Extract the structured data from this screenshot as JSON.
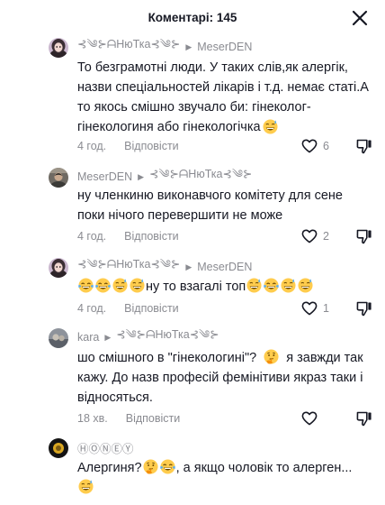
{
  "header": {
    "title": "Коментарі: 145"
  },
  "comments": [
    {
      "author": "⊰༄⊱ᗩНюТка⊰༄⊱",
      "reply_to": "MeserDEN",
      "text": "То безграмотні люди. У таких слів,як алергік, назви спеціальностей лікарів і т.д. немає статі.А то якось смішно звучало би: гінеколог-гінекологиня або гінекологічка",
      "time": "4 год.",
      "reply_label": "Відповісти",
      "likes": "6"
    },
    {
      "author": "MeserDEN",
      "reply_to": "⊰༄⊱ᗩНюТка⊰༄⊱",
      "text": "ну членкиню виконавчого комітету для сене поки нічого перевершити не може",
      "time": "4 год.",
      "reply_label": "Відповісти",
      "likes": "2"
    },
    {
      "author": "⊰༄⊱ᗩНюТка⊰༄⊱",
      "reply_to": "MeserDEN",
      "text": "ну то взагалі топ",
      "time": "4 год.",
      "reply_label": "Відповісти",
      "likes": "1"
    },
    {
      "author": "kara",
      "reply_to": "⊰༄⊱ᗩНюТка⊰༄⊱",
      "text_a": "шо смішного в \"гінекологині\"?",
      "text_b": "я завжди так кажу. До назв професій фемінітиви якраз таки і відносяться.",
      "time": "18 хв.",
      "reply_label": "Відповісти",
      "likes": ""
    },
    {
      "author": "ⒽⓄⓃⒺⓎ",
      "text_a": "Алергиня?",
      "text_b": ", а якщо чоловік то алерген...",
      "time": "",
      "reply_label": "",
      "likes": ""
    }
  ],
  "icons": {
    "close": "close-icon",
    "like": "heart-outline-icon",
    "dislike": "thumbs-down-icon",
    "reply_arrow": "caret-right-icon",
    "emoji_laugh": "grinning-sweat-emoji",
    "emoji_joy": "tears-of-joy-emoji",
    "emoji_think": "thinking-face-emoji"
  },
  "colors": {
    "text": "#161823",
    "muted": "#8a8b91",
    "background": "#ffffff"
  }
}
